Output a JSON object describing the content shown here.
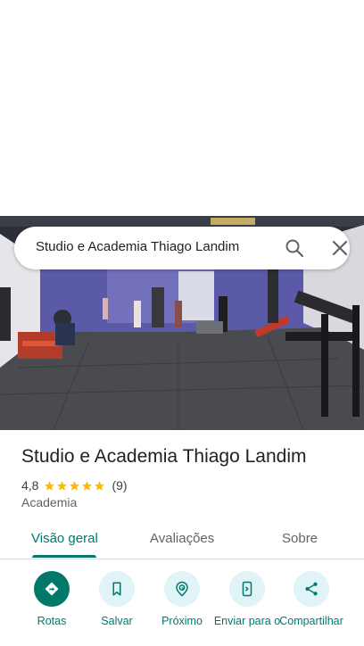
{
  "search": {
    "query": "Studio e Academia Thiago Landim"
  },
  "place": {
    "name": "Studio e Academia Thiago Landim",
    "rating": "4,8",
    "review_count": "(9)",
    "category": "Academia",
    "stars_filled": 5
  },
  "tabs": [
    {
      "label": "Visão geral",
      "active": true
    },
    {
      "label": "Avaliações",
      "active": false
    },
    {
      "label": "Sobre",
      "active": false
    }
  ],
  "actions": [
    {
      "label": "Rotas",
      "icon": "directions-icon"
    },
    {
      "label": "Salvar",
      "icon": "bookmark-icon"
    },
    {
      "label": "Próximo",
      "icon": "nearby-icon"
    },
    {
      "label": "Enviar para o",
      "icon": "send-to-phone-icon"
    },
    {
      "label": "Compartilhar",
      "icon": "share-icon"
    }
  ],
  "colors": {
    "accent": "#00796b",
    "action_bg": "#e0f4f8",
    "star": "#fbbc04"
  }
}
